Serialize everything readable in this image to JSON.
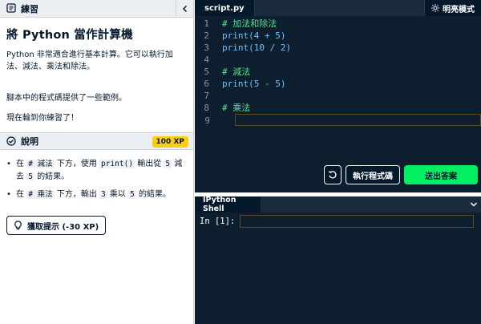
{
  "exercise": {
    "header_label": "練習",
    "title": "將 Python 當作計算機",
    "paragraphs": [
      "Python 非常適合進行基本計算。它可以執行加法、減法、乘法和除法。",
      "腳本中的程式碼提供了一些範例。",
      "現在輪到你練習了！"
    ]
  },
  "instructions": {
    "header_label": "說明",
    "xp": "100 XP",
    "items": [
      {
        "parts": [
          "在 ",
          "# 減法",
          " 下方，使用 ",
          "print()",
          " 輸出從 ",
          "5",
          " 減去 ",
          "5",
          " 的結果。"
        ]
      },
      {
        "parts": [
          "在 ",
          "# 乘法",
          " 下方，輸出 ",
          "3",
          " 乘以 ",
          "5",
          " 的結果。"
        ]
      }
    ],
    "hint_label": "獲取提示 (-30 XP)"
  },
  "editor": {
    "tab": "script.py",
    "theme_toggle": "明亮模式",
    "lines": [
      {
        "num": "1",
        "text": "# 加法和除法"
      },
      {
        "num": "2",
        "text": "print(4 + 5)"
      },
      {
        "num": "3",
        "text": "print(10 / 2)"
      },
      {
        "num": "4",
        "text": ""
      },
      {
        "num": "5",
        "text": "# 減法"
      },
      {
        "num": "6",
        "text": "print(5 - 5)"
      },
      {
        "num": "7",
        "text": ""
      },
      {
        "num": "8",
        "text": "# 乘法"
      },
      {
        "num": "9",
        "text": ""
      }
    ],
    "run_label": "執行程式碼",
    "submit_label": "送出答案"
  },
  "shell": {
    "tab": "IPython Shell",
    "prompt": "In [1]:"
  },
  "colors": {
    "accent_green": "#03ef62",
    "xp_yellow": "#fcce0d",
    "dark_bg": "#05192d"
  }
}
